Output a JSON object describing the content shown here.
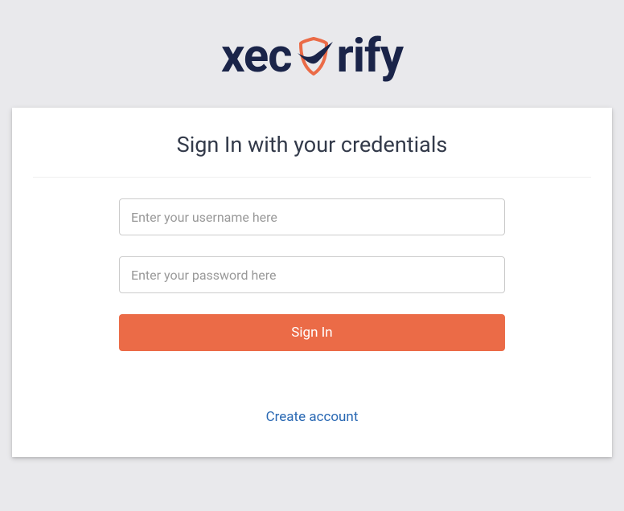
{
  "brand": {
    "text_left": "xec",
    "text_right": "rify",
    "shield_color": "#eb6b47",
    "swoosh_color": "#1a2449",
    "text_color": "#1a2449"
  },
  "card": {
    "title": "Sign In with your credentials"
  },
  "form": {
    "username_placeholder": "Enter your username here",
    "password_placeholder": "Enter your password here",
    "signin_label": "Sign In"
  },
  "links": {
    "create_account": "Create account"
  },
  "colors": {
    "page_bg": "#e9e9ec",
    "card_bg": "#ffffff",
    "accent": "#eb6b47",
    "link": "#2968b3",
    "text_dark": "#333a4a"
  }
}
